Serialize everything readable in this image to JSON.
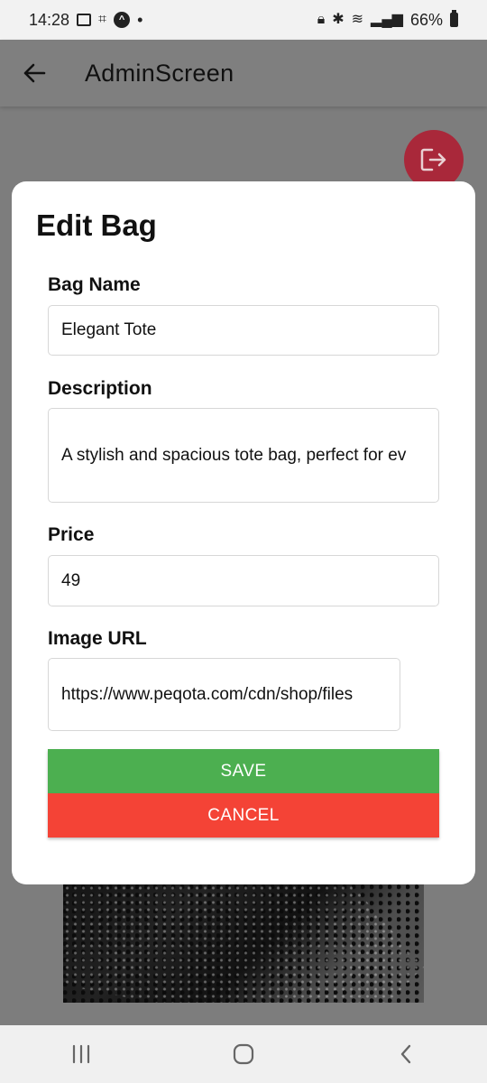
{
  "status_bar": {
    "time": "14:28",
    "dot": "•",
    "battery_text": "66%"
  },
  "app_bar": {
    "title": "AdminScreen"
  },
  "icons": {
    "back": "arrow-left-icon",
    "logout": "logout-icon"
  },
  "colors": {
    "save": "#4caf50",
    "cancel": "#f44336",
    "logout_fab": "#a9283a"
  },
  "modal": {
    "title": "Edit Bag",
    "fields": {
      "name": {
        "label": "Bag Name",
        "value": "Elegant Tote"
      },
      "description": {
        "label": "Description",
        "value": "A stylish and spacious tote bag, perfect for ev"
      },
      "price": {
        "label": "Price",
        "value": "49"
      },
      "image_url": {
        "label": "Image URL",
        "value": "https://www.peqota.com/cdn/shop/files"
      }
    },
    "save_label": "SAVE",
    "cancel_label": "CANCEL"
  }
}
